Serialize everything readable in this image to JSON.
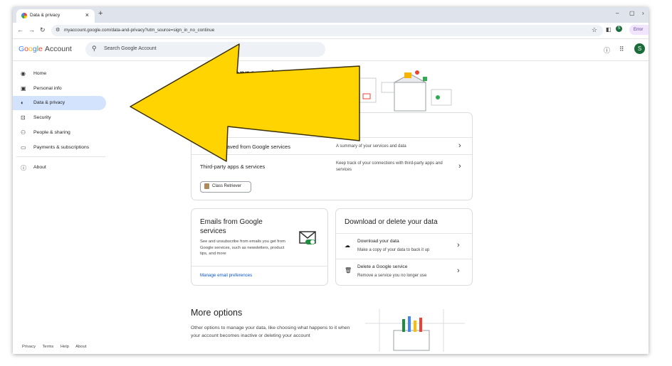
{
  "browser": {
    "tab_title": "Data & privacy",
    "tab_close": "×",
    "new_tab": "+",
    "url": "myaccount.google.com/data-and-privacy?utm_source=sign_in_no_continue",
    "profile_initial": "S",
    "error_label": "Error"
  },
  "header": {
    "logo_g": "G",
    "logo_o1": "o",
    "logo_o2": "o",
    "logo_g2": "g",
    "logo_l": "l",
    "logo_e": "e",
    "logo_account": "Account",
    "search_placeholder": "Search Google Account",
    "avatar_initial": "S"
  },
  "sidebar": {
    "items": [
      {
        "label": "Home",
        "icon": "person-circle-icon"
      },
      {
        "label": "Personal info",
        "icon": "id-card-icon"
      },
      {
        "label": "Data & privacy",
        "icon": "toggle-icon",
        "active": true
      },
      {
        "label": "Security",
        "icon": "lock-icon"
      },
      {
        "label": "People & sharing",
        "icon": "people-icon"
      },
      {
        "label": "Payments & subscriptions",
        "icon": "credit-card-icon"
      },
      {
        "label": "About",
        "icon": "info-icon"
      }
    ],
    "footer": [
      "Privacy",
      "Terms",
      "Help",
      "About"
    ]
  },
  "main": {
    "title_visible": "apps and services you use",
    "apps_card": {
      "row1_title": "saved from Google services",
      "row1_desc": "A summary of your services and data",
      "row2_title": "Third-party apps & services",
      "row2_desc": "Keep track of your connections with third-party apps and services",
      "chip_label": "Class Retriever"
    },
    "emails_card": {
      "title": "Emails from Google services",
      "desc": "See and unsubscribe from emails you get from Google services, such as newsletters, product tips, and more",
      "link": "Manage email preferences"
    },
    "download_card": {
      "title": "Download or delete your data",
      "row1_title": "Download your data",
      "row1_desc": "Make a copy of your data to back it up",
      "row2_title": "Delete a Google service",
      "row2_desc": "Remove a service you no longer use"
    },
    "more": {
      "title": "More options",
      "desc": "Other options to manage your data, like choosing what happens to it when your account becomes inactive or deleting your account"
    }
  },
  "overlay": {
    "arrow_color": "#ffd400",
    "arrow_outline": "#3a3000"
  }
}
